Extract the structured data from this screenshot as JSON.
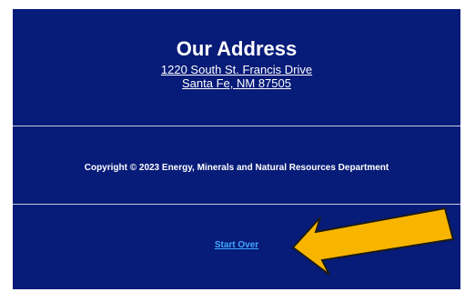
{
  "footer": {
    "heading": "Our Address",
    "address_line1": "1220 South St. Francis Drive",
    "address_line2": "Santa Fe, NM 87505",
    "copyright": "Copyright © 2023 Energy, Minerals and Natural Resources Department",
    "start_over_label": "Start Over"
  },
  "colors": {
    "background": "#071b78",
    "text": "#ffffff",
    "link_accent": "#3fa9ff",
    "arrow_fill": "#f7b500",
    "arrow_outline": "#1a1a1a"
  },
  "annotation": {
    "icon": "arrow-pointing-left-icon"
  }
}
